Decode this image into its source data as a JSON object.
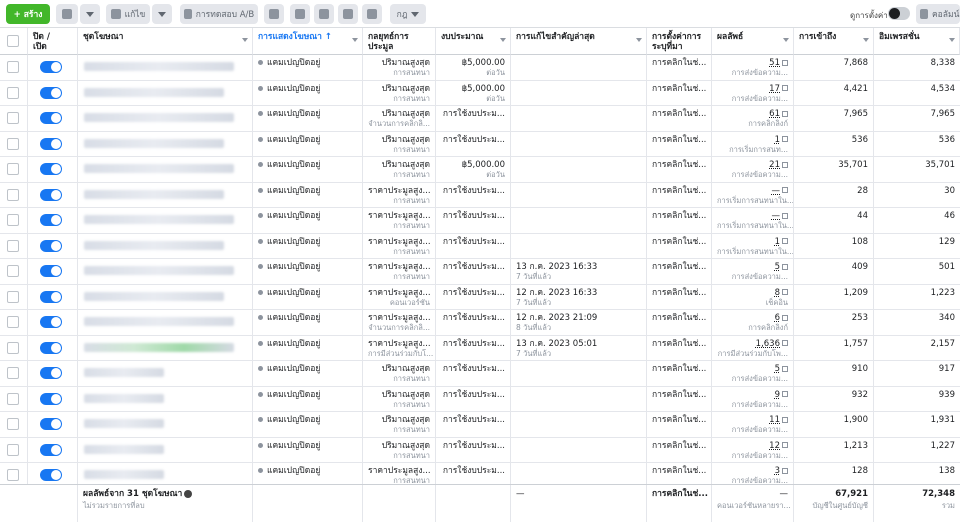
{
  "toolbar": {
    "create_label": "+ สร้าง",
    "edit_label": "แก้ไข",
    "ab_test_label": "การทดสอบ A/B",
    "rules_label": "กฎ",
    "settings_label": "ดูการตั้งค่า",
    "columns_label": "คอลัมน์"
  },
  "columns": {
    "onoff": "ปิด / เปิด",
    "adset": "ชุดโฆษณา",
    "delivery": "การแสดงโฆษณา ↑",
    "bid_strategy": "กลยุทธ์การประมูล",
    "budget": "งบประมาณ",
    "last_edit": "การแก้ไขสำคัญล่าสุด",
    "attribution": "การตั้งค่าการระบุที่มา",
    "results": "ผลลัพธ์",
    "reach": "การเข้าถึง",
    "impressions": "อิมเพรสชั่น"
  },
  "rows": [
    {
      "delivery": "แคมเปญปิดอยู่",
      "bid": "ปริมาณสูงสุด",
      "bid_sub": "การสนทนา",
      "budget": "฿5,000.00",
      "budget_sub": "ต่อวัน",
      "edit": "",
      "edit_sub": "",
      "attr": "การคลิกในช่...",
      "result": "51",
      "result_sub": "การส่งข้อความ...",
      "reach": "7,868",
      "impr": "8,338"
    },
    {
      "delivery": "แคมเปญปิดอยู่",
      "bid": "ปริมาณสูงสุด",
      "bid_sub": "การสนทนา",
      "budget": "฿5,000.00",
      "budget_sub": "ต่อวัน",
      "edit": "",
      "edit_sub": "",
      "attr": "การคลิกในช่...",
      "result": "17",
      "result_sub": "การส่งข้อความ...",
      "reach": "4,421",
      "impr": "4,534"
    },
    {
      "delivery": "แคมเปญปิดอยู่",
      "bid": "ปริมาณสูงสุด",
      "bid_sub": "จำนวนการคลิกลิ...",
      "budget": "การใช้งบประม...",
      "budget_sub": "",
      "edit": "",
      "edit_sub": "",
      "attr": "การคลิกในช่...",
      "result": "61",
      "result_sub": "การคลิกลิงก์",
      "reach": "7,965",
      "impr": "7,965"
    },
    {
      "delivery": "แคมเปญปิดอยู่",
      "bid": "ปริมาณสูงสุด",
      "bid_sub": "การสนทนา",
      "budget": "การใช้งบประม...",
      "budget_sub": "",
      "edit": "",
      "edit_sub": "",
      "attr": "การคลิกในช่...",
      "result": "1",
      "result_sub": "การเริ่มการสนท...",
      "reach": "536",
      "impr": "536"
    },
    {
      "delivery": "แคมเปญปิดอยู่",
      "bid": "ปริมาณสูงสุด",
      "bid_sub": "การสนทนา",
      "budget": "฿5,000.00",
      "budget_sub": "ต่อวัน",
      "edit": "",
      "edit_sub": "",
      "attr": "การคลิกในช่...",
      "result": "21",
      "result_sub": "การส่งข้อความ...",
      "reach": "35,701",
      "impr": "35,701"
    },
    {
      "delivery": "แคมเปญปิดอยู่",
      "bid": "ราคาประมูลสูง...",
      "bid_sub": "การสนทนา",
      "budget": "การใช้งบประม...",
      "budget_sub": "",
      "edit": "",
      "edit_sub": "",
      "attr": "การคลิกในช่...",
      "result": "—",
      "result_sub": "การเริ่มการสนทนาใน...",
      "reach": "28",
      "impr": "30"
    },
    {
      "delivery": "แคมเปญปิดอยู่",
      "bid": "ราคาประมูลสูง...",
      "bid_sub": "การสนทนา",
      "budget": "การใช้งบประม...",
      "budget_sub": "",
      "edit": "",
      "edit_sub": "",
      "attr": "การคลิกในช่...",
      "result": "—",
      "result_sub": "การเริ่มการสนทนาใน...",
      "reach": "44",
      "impr": "46"
    },
    {
      "delivery": "แคมเปญปิดอยู่",
      "bid": "ราคาประมูลสูง...",
      "bid_sub": "การสนทนา",
      "budget": "การใช้งบประม...",
      "budget_sub": "",
      "edit": "",
      "edit_sub": "",
      "attr": "การคลิกในช่...",
      "result": "1",
      "result_sub": "การเริ่มการสนทนาใน...",
      "reach": "108",
      "impr": "129"
    },
    {
      "delivery": "แคมเปญปิดอยู่",
      "bid": "ราคาประมูลสูง...",
      "bid_sub": "การสนทนา",
      "budget": "การใช้งบประม...",
      "budget_sub": "",
      "edit": "13 ก.ค. 2023 16:33",
      "edit_sub": "7 วันที่แล้ว",
      "attr": "การคลิกในช่...",
      "result": "5",
      "result_sub": "การส่งข้อความ...",
      "reach": "409",
      "impr": "501"
    },
    {
      "delivery": "แคมเปญปิดอยู่",
      "bid": "ราคาประมูลสูง...",
      "bid_sub": "คอนเวอร์ชัน",
      "budget": "การใช้งบประม...",
      "budget_sub": "",
      "edit": "12 ก.ค. 2023 16:33",
      "edit_sub": "7 วันที่แล้ว",
      "attr": "การคลิกในช่...",
      "result": "8",
      "result_sub": "เช็คอิน",
      "reach": "1,209",
      "impr": "1,223"
    },
    {
      "delivery": "แคมเปญปิดอยู่",
      "bid": "ราคาประมูลสูง...",
      "bid_sub": "จำนวนการคลิกลิ...",
      "budget": "การใช้งบประม...",
      "budget_sub": "",
      "edit": "12 ก.ค. 2023 21:09",
      "edit_sub": "8 วันที่แล้ว",
      "attr": "การคลิกในช่...",
      "result": "6",
      "result_sub": "การคลิกลิงก์",
      "reach": "253",
      "impr": "340"
    },
    {
      "delivery": "แคมเปญปิดอยู่",
      "bid": "ราคาประมูลสูง...",
      "bid_sub": "การมีส่วนร่วมกับโ...",
      "budget": "การใช้งบประม...",
      "budget_sub": "",
      "edit": "13 ก.ค. 2023 05:01",
      "edit_sub": "7 วันที่แล้ว",
      "attr": "การคลิกในช่...",
      "result": "1,636",
      "result_sub": "การมีส่วนร่วมกับโพ...",
      "reach": "1,757",
      "impr": "2,157"
    },
    {
      "delivery": "แคมเปญปิดอยู่",
      "bid": "ปริมาณสูงสุด",
      "bid_sub": "การสนทนา",
      "budget": "การใช้งบประม...",
      "budget_sub": "",
      "edit": "",
      "edit_sub": "",
      "attr": "การคลิกในช่...",
      "result": "5",
      "result_sub": "การส่งข้อความ...",
      "reach": "910",
      "impr": "917"
    },
    {
      "delivery": "แคมเปญปิดอยู่",
      "bid": "ปริมาณสูงสุด",
      "bid_sub": "การสนทนา",
      "budget": "การใช้งบประม...",
      "budget_sub": "",
      "edit": "",
      "edit_sub": "",
      "attr": "การคลิกในช่...",
      "result": "9",
      "result_sub": "การส่งข้อความ...",
      "reach": "932",
      "impr": "939"
    },
    {
      "delivery": "แคมเปญปิดอยู่",
      "bid": "ปริมาณสูงสุด",
      "bid_sub": "การสนทนา",
      "budget": "การใช้งบประม...",
      "budget_sub": "",
      "edit": "",
      "edit_sub": "",
      "attr": "การคลิกในช่...",
      "result": "11",
      "result_sub": "การส่งข้อความ...",
      "reach": "1,900",
      "impr": "1,931"
    },
    {
      "delivery": "แคมเปญปิดอยู่",
      "bid": "ปริมาณสูงสุด",
      "bid_sub": "การสนทนา",
      "budget": "การใช้งบประม...",
      "budget_sub": "",
      "edit": "",
      "edit_sub": "",
      "attr": "การคลิกในช่...",
      "result": "12",
      "result_sub": "การส่งข้อความ...",
      "reach": "1,213",
      "impr": "1,227"
    },
    {
      "delivery": "แคมเปญปิดอยู่",
      "bid": "ราคาประมูลสูง...",
      "bid_sub": "การสนทนา",
      "budget": "การใช้งบประม...",
      "budget_sub": "",
      "edit": "",
      "edit_sub": "",
      "attr": "การคลิกในช่...",
      "result": "3",
      "result_sub": "การส่งข้อความ...",
      "reach": "128",
      "impr": "138"
    }
  ],
  "footer": {
    "summary": "ผลลัพธ์จาก 31 ชุดโฆษณา",
    "summary_sub": "ไม่รวมรายการที่ลบ",
    "last_edit": "—",
    "attr": "การคลิกในช่...",
    "result": "—",
    "result_sub": "คอนเวอร์ชันหลายรา...",
    "reach": "67,921",
    "reach_sub": "บัญชีในศูนย์บัญชี",
    "impr": "72,348",
    "impr_sub": "รวม"
  }
}
